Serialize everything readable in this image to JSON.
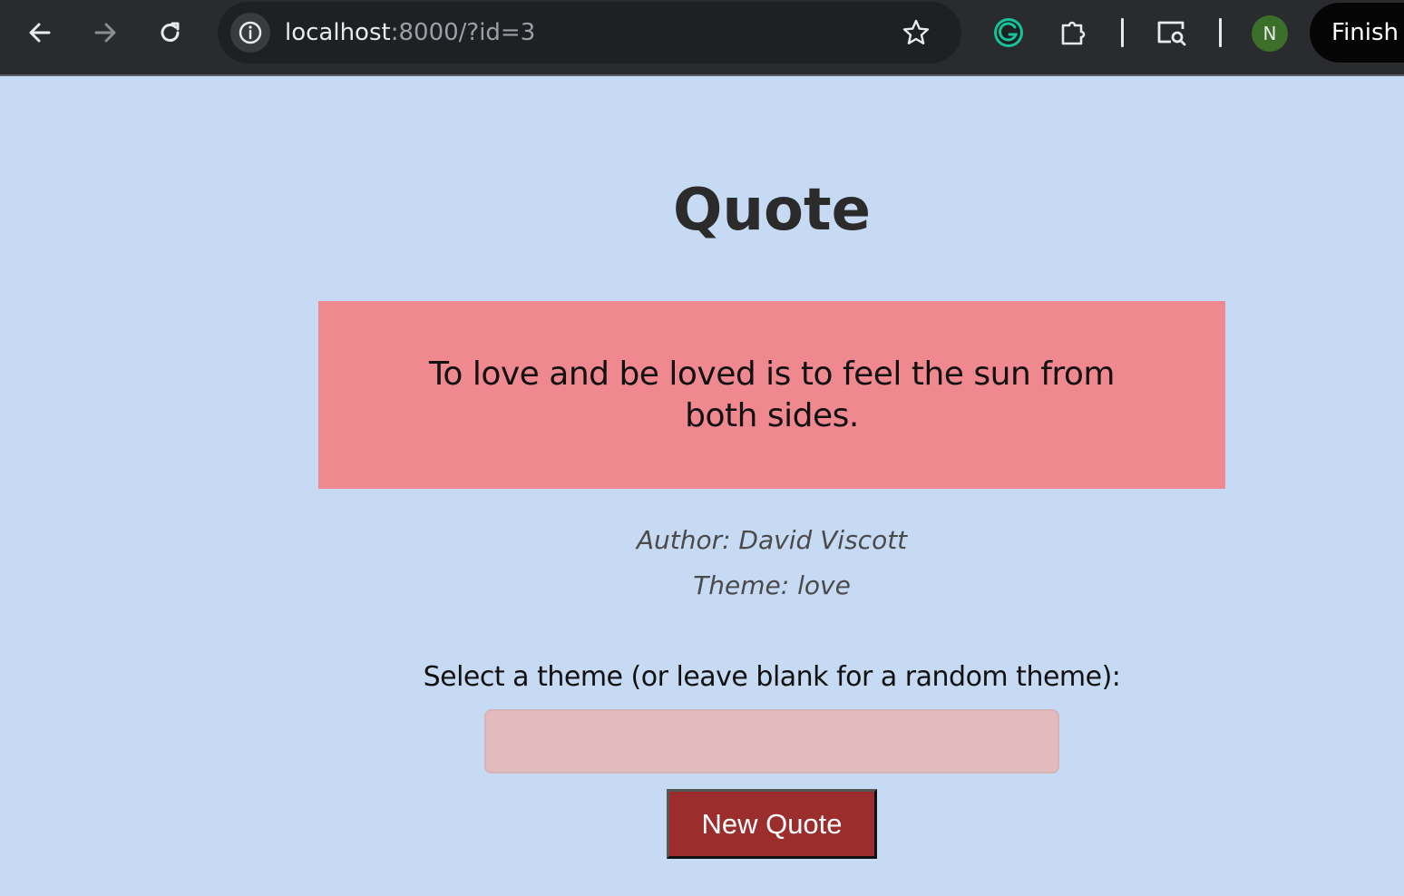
{
  "browser": {
    "url_host": "localhost",
    "url_rest": ":8000/?id=3",
    "profile_initial": "N",
    "finish_label": "Finish",
    "icons": {
      "back": "back-arrow-icon",
      "forward": "forward-arrow-icon",
      "reload": "reload-icon",
      "site_info": "info-icon",
      "bookmark": "star-icon",
      "grammarly": "grammarly-icon",
      "extensions": "puzzle-piece-icon",
      "media": "search-in-page-icon"
    }
  },
  "page": {
    "title": "Quote",
    "quote": "To love and be loved is to feel the sun from both sides.",
    "author_line": "Author: David Viscott",
    "theme_line": "Theme: love",
    "theme_prompt": "Select a theme (or leave blank for a random theme):",
    "theme_input_value": "",
    "new_quote_label": "New Quote"
  },
  "colors": {
    "background": "#c6daf3",
    "quote_box": "#f08890",
    "input_bg": "#e1bbbd",
    "button_bg": "#9b2d2c",
    "title": "#2b2b2b"
  }
}
